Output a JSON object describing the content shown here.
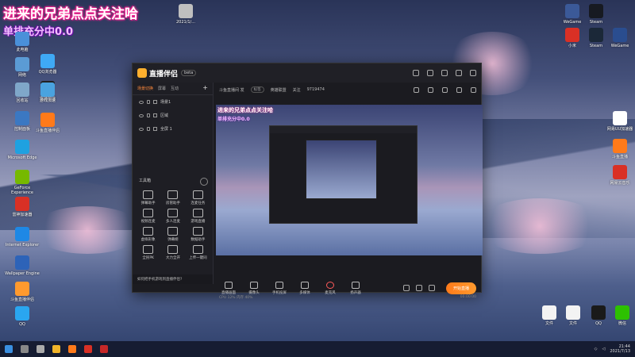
{
  "overlay": {
    "line1": "进来的兄弟点点关注哈",
    "line2": "单排充分中0.0"
  },
  "desktop": {
    "left_icons": [
      {
        "label": "2021/1/...",
        "color": "#bfbfbf"
      },
      {
        "label": "此电脑",
        "color": "#4a90d9"
      },
      {
        "label": "QQ浏览器",
        "color": "#3fa9f5"
      },
      {
        "label": "网络",
        "color": "#5b9bd5"
      },
      {
        "label": "雷神加速",
        "color": "#222222"
      },
      {
        "label": "回收站",
        "color": "#7fa7c9"
      },
      {
        "label": "游戏加速",
        "color": "#4aa3df"
      },
      {
        "label": "控制面板",
        "color": "#3b78c2"
      },
      {
        "label": "斗鱼直播伴侣",
        "color": "#ff7a1a"
      },
      {
        "label": "Microsoft Edge",
        "color": "#1fa1e0"
      },
      {
        "label": "GeForce Experience",
        "color": "#76b900"
      },
      {
        "label": "雷神加速器",
        "color": "#d93025"
      },
      {
        "label": "Internet Explorer",
        "color": "#1e88e5"
      },
      {
        "label": "Wallpaper Engine",
        "color": "#2d63b8"
      },
      {
        "label": "斗鱼直播伴侣",
        "color": "#ff9a2e"
      },
      {
        "label": "QQ",
        "color": "#2aa6f0"
      }
    ],
    "right_icons": [
      {
        "label": "WeGame",
        "color": "#3b5998"
      },
      {
        "label": "Steam",
        "color": "#171a21"
      },
      {
        "label": "小米",
        "color": "#d93025"
      },
      {
        "label": "Steam",
        "color": "#1b2838"
      },
      {
        "label": "WeGame",
        "color": "#2a4d8f"
      },
      {
        "label": "网易UU加速器",
        "color": "#ffffff"
      },
      {
        "label": "斗鱼直播",
        "color": "#ff7a1a"
      },
      {
        "label": "网易云音乐",
        "color": "#d93025"
      },
      {
        "label": "文件",
        "color": "#f3f3f3"
      },
      {
        "label": "文件",
        "color": "#f3f3f3"
      },
      {
        "label": "QQ",
        "color": "#1a1a1a"
      },
      {
        "label": "微信",
        "color": "#2dc100"
      }
    ]
  },
  "window": {
    "app_name": "直播伴侣",
    "version": "beta",
    "tabs": [
      "场景切换",
      "屏幕",
      "互动"
    ],
    "sources": [
      "场景1",
      "区域",
      "全屏 1"
    ],
    "tools_title": "工具箱",
    "tools": [
      "弹幕助手",
      "房管助手",
      "连麦任务",
      "视频连麦",
      "多人连麦",
      "游戏直播",
      "虚拟形象",
      "弹幕姬",
      "数据助手",
      "全民PK",
      "大力全开",
      "上传一键同"
    ],
    "tip": "如何把手机游戏到直播伴侣?",
    "info": {
      "room": "斗鱼直播间  发",
      "badge": "标签",
      "category": "英雄联盟",
      "follow_label": "关注",
      "follow_count": "9719474"
    },
    "preview": {
      "line1": "进来的兄弟点点关注哈",
      "line2": "单排充分中0.0"
    },
    "bottom_buttons": [
      "直播画面",
      "摄像头",
      "手机投屏",
      "多媒体",
      "麦克风",
      "扬声器"
    ],
    "live_button": "开始直播",
    "status_left": "CPU 12%  内存 40%",
    "status_right": "00:00:00"
  },
  "taskbar": {
    "time": "21:44",
    "date": "2021/7/13"
  }
}
